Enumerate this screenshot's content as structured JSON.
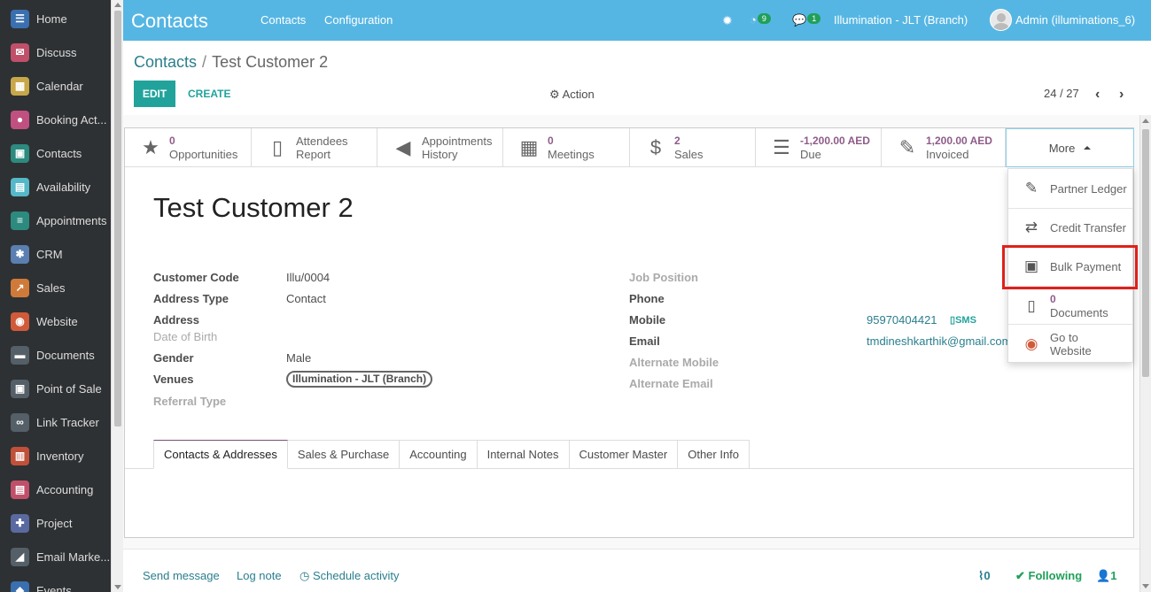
{
  "sidebar": {
    "items": [
      {
        "label": "Home",
        "icon": "home-icon",
        "color": "#3a6fb0",
        "glyph": "☰"
      },
      {
        "label": "Discuss",
        "icon": "discuss-icon",
        "color": "#c0506a",
        "glyph": "✉"
      },
      {
        "label": "Calendar",
        "icon": "calendar-icon",
        "color": "#c8a74a",
        "glyph": "▦"
      },
      {
        "label": "Booking Act...",
        "icon": "booking-icon",
        "color": "#c05080",
        "glyph": "●"
      },
      {
        "label": "Contacts",
        "icon": "contacts-icon",
        "color": "#2d8a7f",
        "glyph": "▣"
      },
      {
        "label": "Availability",
        "icon": "availability-icon",
        "color": "#55b8c8",
        "glyph": "▤"
      },
      {
        "label": "Appointments",
        "icon": "appointments-icon",
        "color": "#2d8a7f",
        "glyph": "≡"
      },
      {
        "label": "CRM",
        "icon": "crm-icon",
        "color": "#5a7fb0",
        "glyph": "✱"
      },
      {
        "label": "Sales",
        "icon": "sales-icon",
        "color": "#d07a3a",
        "glyph": "↗"
      },
      {
        "label": "Website",
        "icon": "website-icon",
        "color": "#d05a3a",
        "glyph": "◉"
      },
      {
        "label": "Documents",
        "icon": "documents-icon",
        "color": "#555f68",
        "glyph": "▬"
      },
      {
        "label": "Point of Sale",
        "icon": "pos-icon",
        "color": "#555f68",
        "glyph": "▣"
      },
      {
        "label": "Link Tracker",
        "icon": "link-tracker-icon",
        "color": "#555f68",
        "glyph": "∞"
      },
      {
        "label": "Inventory",
        "icon": "inventory-icon",
        "color": "#c0503a",
        "glyph": "▥"
      },
      {
        "label": "Accounting",
        "icon": "accounting-icon",
        "color": "#c0506a",
        "glyph": "▤"
      },
      {
        "label": "Project",
        "icon": "project-icon",
        "color": "#5a6aa0",
        "glyph": "✚"
      },
      {
        "label": "Email Marke...",
        "icon": "email-marketing-icon",
        "color": "#555f68",
        "glyph": "◢"
      },
      {
        "label": "Events",
        "icon": "events-icon",
        "color": "#3a6fb0",
        "glyph": "◆"
      }
    ]
  },
  "topbar": {
    "brand": "Contacts",
    "menu": [
      "Contacts",
      "Configuration"
    ],
    "activity_count": "9",
    "message_count": "1",
    "company": "Illumination - JLT (Branch)",
    "user": "Admin (illuminations_6)"
  },
  "breadcrumb": {
    "parent": "Contacts",
    "separator": "/",
    "current": "Test Customer 2"
  },
  "controls": {
    "edit": "EDIT",
    "create": "CREATE",
    "action": "Action",
    "pager": "24 / 27"
  },
  "smart_buttons": [
    {
      "icon": "star-icon",
      "glyph": "★",
      "value": "0",
      "label": "Opportunities"
    },
    {
      "icon": "file-icon",
      "glyph": "▯",
      "value": "Attendees",
      "label": "Report",
      "plain": true
    },
    {
      "icon": "bullhorn-icon",
      "glyph": "◀",
      "value": "Appointments",
      "label": "History",
      "plain": true
    },
    {
      "icon": "calendar-icon",
      "glyph": "▦",
      "value": "0",
      "label": "Meetings"
    },
    {
      "icon": "dollar-icon",
      "glyph": "$",
      "value": "2",
      "label": "Sales"
    },
    {
      "icon": "list-icon",
      "glyph": "☰",
      "value": "-1,200.00 AED",
      "label": "Due"
    },
    {
      "icon": "edit-icon",
      "glyph": "✎",
      "value": "1,200.00 AED",
      "label": "Invoiced"
    }
  ],
  "more_label": "More",
  "customer_name": "Test Customer 2",
  "fields_left": [
    {
      "label": "Customer Code",
      "value": "Illu/0004"
    },
    {
      "label": "Address Type",
      "value": "Contact"
    },
    {
      "label": "Address",
      "value": ""
    },
    {
      "label": "Date of Birth",
      "value": ""
    },
    {
      "label": "Gender",
      "value": "Male"
    },
    {
      "label": "Venues",
      "value": "Illumination - JLT (Branch)"
    },
    {
      "label": "Referral Type",
      "value": ""
    }
  ],
  "fields_right": [
    {
      "label": "Job Position",
      "value": ""
    },
    {
      "label": "Phone",
      "value": ""
    },
    {
      "label": "Mobile",
      "value": "95970404421"
    },
    {
      "label": "Email",
      "value": "tmdineshkarthik@gmail.com"
    },
    {
      "label": "Alternate Mobile",
      "value": ""
    },
    {
      "label": "Alternate Email",
      "value": ""
    }
  ],
  "sms_label": "SMS",
  "tabs": [
    "Contacts & Addresses",
    "Sales & Purchase",
    "Accounting",
    "Internal Notes",
    "Customer Master",
    "Other Info"
  ],
  "dropdown": {
    "partner_ledger": "Partner Ledger",
    "credit_transfer": "Credit Transfer",
    "bulk_payment": "Bulk Payment",
    "documents_count": "0",
    "documents_label": "Documents",
    "go_to_label1": "Go to",
    "go_to_label2": "Website"
  },
  "chatter": {
    "send_message": "Send message",
    "log_note": "Log note",
    "schedule_activity": "Schedule activity",
    "attachments": "0",
    "following": "Following",
    "followers": "1"
  },
  "colors": {
    "topbar": "#56b6e3",
    "primary": "#21a39b",
    "highlight": "#e0201b",
    "sidebar": "#2e3133"
  }
}
